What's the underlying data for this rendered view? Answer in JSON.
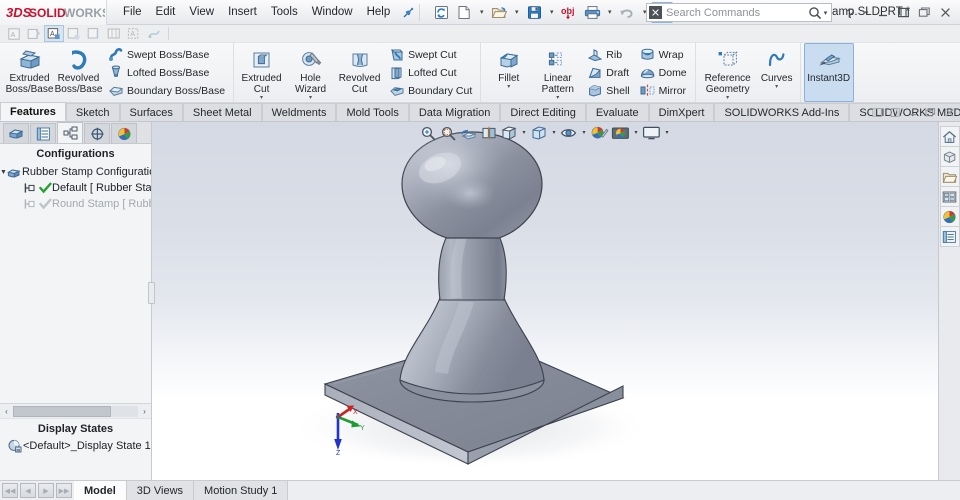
{
  "app": {
    "brand": "SOLIDWORKS",
    "brand_prefix": "3DS",
    "document_title": "Rubber Stamp.SLDPRT *"
  },
  "menu": {
    "items": [
      {
        "label": "File"
      },
      {
        "label": "Edit"
      },
      {
        "label": "View"
      },
      {
        "label": "Insert"
      },
      {
        "label": "Tools"
      },
      {
        "label": "Window"
      },
      {
        "label": "Help"
      }
    ],
    "pin_icon": "pushpin-icon"
  },
  "quick_access": {
    "buttons": [
      {
        "name": "new-document-rebuild-icon",
        "icon": "rebuild-icon"
      },
      {
        "name": "new-document-icon",
        "icon": "new-document-icon",
        "caret": true
      },
      {
        "name": "open-document-icon",
        "icon": "open-folder-icon",
        "caret": true
      },
      {
        "name": "save-icon",
        "icon": "save-floppy-icon",
        "caret": true
      },
      {
        "name": "print-obj-icon",
        "icon": "obj-label-icon"
      },
      {
        "name": "print-icon",
        "icon": "printer-icon",
        "caret": true
      },
      {
        "name": "undo-icon",
        "icon": "undo-arrow-icon",
        "caret": true
      },
      {
        "name": "select-icon",
        "icon": "cursor-arrow-icon",
        "caret": true,
        "active": true
      },
      {
        "name": "rebuild-status-icon",
        "icon": "traffic-light-icon"
      },
      {
        "name": "file-properties-icon",
        "icon": "properties-list-icon"
      },
      {
        "name": "options-icon",
        "icon": "gear-icon",
        "caret": true
      }
    ]
  },
  "search": {
    "placeholder": "Search Commands",
    "value": "",
    "badge": "swx",
    "magnifier_icon": "magnifier-icon",
    "caret": true
  },
  "window_controls": {
    "help_label": "?",
    "minimize_label": "–",
    "restore_label": "restore-icon",
    "maximize_label": "maximize-icon",
    "close_label": "✕"
  },
  "mini_toolbar": {
    "buttons": [
      {
        "name": "smart-dimension-icon",
        "enabled": false
      },
      {
        "name": "dimxpert-auto-icon",
        "enabled": false
      },
      {
        "name": "location-dimension-icon",
        "enabled": false,
        "active": true
      },
      {
        "name": "size-dimension-icon",
        "enabled": false
      },
      {
        "name": "datum-icon",
        "enabled": false
      },
      {
        "name": "geometric-tolerance-icon",
        "enabled": false
      },
      {
        "name": "pattern-feature-icon",
        "enabled": false
      },
      {
        "name": "show-tolerance-status-icon",
        "enabled": false
      }
    ]
  },
  "ribbon": {
    "groups": [
      {
        "name": "boss-base",
        "big": [
          {
            "label": "Extruded\nBoss/Base",
            "icon": "extruded-boss-icon",
            "dropdown": false
          },
          {
            "label": "Revolved\nBoss/Base",
            "icon": "revolved-boss-icon",
            "dropdown": false
          }
        ],
        "small": [
          {
            "label": "Swept Boss/Base",
            "icon": "swept-boss-icon"
          },
          {
            "label": "Lofted Boss/Base",
            "icon": "lofted-boss-icon"
          },
          {
            "label": "Boundary Boss/Base",
            "icon": "boundary-boss-icon"
          }
        ]
      },
      {
        "name": "cut",
        "big": [
          {
            "label": "Extruded\nCut",
            "icon": "extruded-cut-icon",
            "dropdown": true
          },
          {
            "label": "Hole\nWizard",
            "icon": "hole-wizard-icon",
            "dropdown": true
          },
          {
            "label": "Revolved\nCut",
            "icon": "revolved-cut-icon",
            "dropdown": false
          }
        ],
        "small": [
          {
            "label": "Swept Cut",
            "icon": "swept-cut-icon"
          },
          {
            "label": "Lofted Cut",
            "icon": "lofted-cut-icon"
          },
          {
            "label": "Boundary Cut",
            "icon": "boundary-cut-icon"
          }
        ]
      },
      {
        "name": "features",
        "big": [
          {
            "label": "Fillet",
            "icon": "fillet-icon",
            "dropdown": true
          },
          {
            "label": "Linear\nPattern",
            "icon": "linear-pattern-icon",
            "dropdown": true
          }
        ],
        "small": [
          {
            "label": "Rib",
            "icon": "rib-icon"
          },
          {
            "label": "Draft",
            "icon": "draft-icon"
          },
          {
            "label": "Shell",
            "icon": "shell-icon"
          }
        ],
        "small2": [
          {
            "label": "Wrap",
            "icon": "wrap-icon"
          },
          {
            "label": "Dome",
            "icon": "dome-icon"
          },
          {
            "label": "Mirror",
            "icon": "mirror-icon"
          }
        ]
      },
      {
        "name": "reference",
        "big": [
          {
            "label": "Reference\nGeometry",
            "icon": "reference-geometry-icon",
            "dropdown": true
          },
          {
            "label": "Curves",
            "icon": "curves-icon",
            "dropdown": true
          }
        ]
      },
      {
        "name": "instant3d",
        "big": [
          {
            "label": "Instant3D",
            "icon": "instant3d-icon",
            "dropdown": false,
            "selected": true
          }
        ]
      }
    ]
  },
  "command_tabs": {
    "active": "Features",
    "items": [
      {
        "label": "Features"
      },
      {
        "label": "Sketch"
      },
      {
        "label": "Surfaces"
      },
      {
        "label": "Sheet Metal"
      },
      {
        "label": "Weldments"
      },
      {
        "label": "Mold Tools"
      },
      {
        "label": "Data Migration"
      },
      {
        "label": "Direct Editing"
      },
      {
        "label": "Evaluate"
      },
      {
        "label": "DimXpert"
      },
      {
        "label": "SOLIDWORKS Add-Ins"
      },
      {
        "label": "SOLIDWORKS MBD"
      }
    ],
    "window_buttons": [
      {
        "name": "pin-panel-icon",
        "glyph": "restore-icon"
      },
      {
        "name": "collapse-panel-icon",
        "glyph": "restore-icon"
      },
      {
        "name": "minimize-doc-icon",
        "glyph": "–"
      },
      {
        "name": "restore-doc-icon",
        "glyph": "restore-icon"
      },
      {
        "name": "close-doc-icon",
        "glyph": "✕"
      }
    ]
  },
  "tree_panel": {
    "tabs": [
      {
        "name": "feature-manager-tab",
        "icon": "feature-tree-icon"
      },
      {
        "name": "property-manager-tab",
        "icon": "property-list-icon"
      },
      {
        "name": "configuration-manager-tab",
        "icon": "configuration-icon",
        "active": true
      },
      {
        "name": "dimxpert-manager-tab",
        "icon": "dimxpert-target-icon"
      },
      {
        "name": "display-manager-tab",
        "icon": "display-appearance-icon"
      }
    ],
    "configurations_header": "Configurations",
    "root": {
      "label": "Rubber Stamp Configuration(",
      "icon": "configuration-root-icon",
      "expanded": true
    },
    "items": [
      {
        "label": "Default [ Rubber Sta",
        "icon": "config-item-icon",
        "check": "active-check",
        "dim": false
      },
      {
        "label": "Round Stamp [ Rubb",
        "icon": "config-item-icon",
        "check": "inactive-check",
        "dim": true
      }
    ],
    "display_states_header": "Display States",
    "display_states": [
      {
        "label": "<Default>_Display State 1",
        "icon": "display-state-icon"
      }
    ],
    "hscroll": {
      "left_arrow": "‹",
      "right_arrow": "›"
    }
  },
  "viewport": {
    "hud": [
      {
        "name": "zoom-to-fit-icon",
        "caret": false
      },
      {
        "name": "zoom-to-area-icon",
        "caret": false
      },
      {
        "name": "previous-view-icon",
        "caret": false
      },
      {
        "name": "section-view-icon",
        "caret": false
      },
      {
        "name": "view-orientation-icon",
        "caret": true
      },
      {
        "name": "display-style-icon",
        "caret": true
      },
      {
        "name": "hide-show-items-icon",
        "caret": true
      },
      {
        "name": "edit-appearance-icon",
        "caret": false
      },
      {
        "name": "apply-scene-icon",
        "caret": true
      },
      {
        "name": "view-settings-icon",
        "caret": true
      }
    ],
    "triad": {
      "x_label": "X",
      "y_label": "Y",
      "z_label": "Z",
      "x_color": "#cc2222",
      "y_color": "#1e9d34",
      "z_color": "#2233cc"
    },
    "model": {
      "name": "rubber-stamp-model",
      "body_color_light": "#b7bcc7",
      "body_color_mid": "#8d93a1",
      "body_color_dark": "#6f7585",
      "edge_color": "#3c404b",
      "background_top": "#d5d9e3",
      "background_bottom": "#ffffff"
    }
  },
  "task_pane": {
    "buttons": [
      {
        "name": "home-icon"
      },
      {
        "name": "3d-content-central-icon"
      },
      {
        "name": "design-library-icon"
      },
      {
        "name": "view-palette-icon"
      },
      {
        "name": "appearances-scenes-icon"
      },
      {
        "name": "custom-properties-icon"
      }
    ]
  },
  "status_bar": {
    "nav_buttons": [
      {
        "glyph": "◀◀",
        "disabled": true
      },
      {
        "glyph": "◀",
        "disabled": true
      },
      {
        "glyph": "▶",
        "disabled": true
      },
      {
        "glyph": "▶▶",
        "disabled": true
      }
    ],
    "tabs": [
      {
        "label": "Model",
        "active": true
      },
      {
        "label": "3D Views",
        "active": false
      },
      {
        "label": "Motion Study 1",
        "active": false
      }
    ]
  },
  "colors": {
    "brand_red": "#c8102e",
    "accent_blue": "#2c6fb5",
    "selected_tab": "#c9dcf0",
    "check_green": "#27a034"
  }
}
